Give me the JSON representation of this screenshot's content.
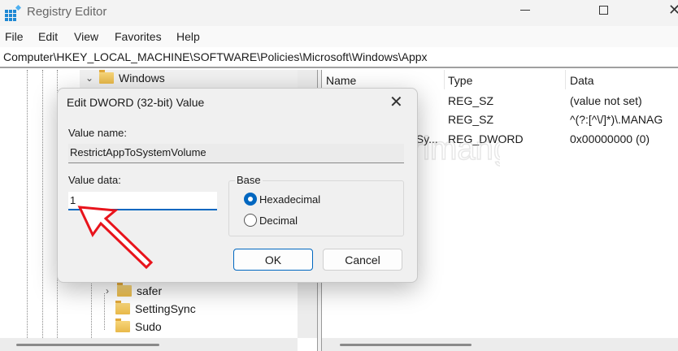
{
  "window": {
    "title": "Registry Editor",
    "minimize_icon": "minimize-icon",
    "maximize_icon": "maximize-icon",
    "close_icon": "close-icon"
  },
  "menu": [
    "File",
    "Edit",
    "View",
    "Favorites",
    "Help"
  ],
  "address": "Computer\\HKEY_LOCAL_MACHINE\\SOFTWARE\\Policies\\Microsoft\\Windows\\Appx",
  "tree": {
    "top": "Windows",
    "bottom": [
      "safer",
      "SettingSync",
      "Sudo"
    ]
  },
  "list": {
    "columns": [
      "Name",
      "Type",
      "Data"
    ],
    "rows": [
      {
        "name": "",
        "type": "REG_SZ",
        "data": "(value not set)"
      },
      {
        "name": "",
        "type": "REG_SZ",
        "data": "^(?:[^\\/]*)\\.MANAG"
      },
      {
        "name": "oSy...",
        "type": "REG_DWORD",
        "data": "0x00000000 (0)"
      }
    ]
  },
  "dialog": {
    "title": "Edit DWORD (32-bit) Value",
    "value_name_label": "Value name:",
    "value_name": "RestrictAppToSystemVolume",
    "value_data_label": "Value data:",
    "value_data": "1",
    "base_label": "Base",
    "base_options": [
      {
        "label": "Hexadecimal",
        "selected": true
      },
      {
        "label": "Decimal",
        "selected": false
      }
    ],
    "ok": "OK",
    "cancel": "Cancel"
  },
  "annotation": {
    "arrow_color": "#e8141c"
  },
  "watermark": "Quantrimang",
  "accent": "#0067c0"
}
